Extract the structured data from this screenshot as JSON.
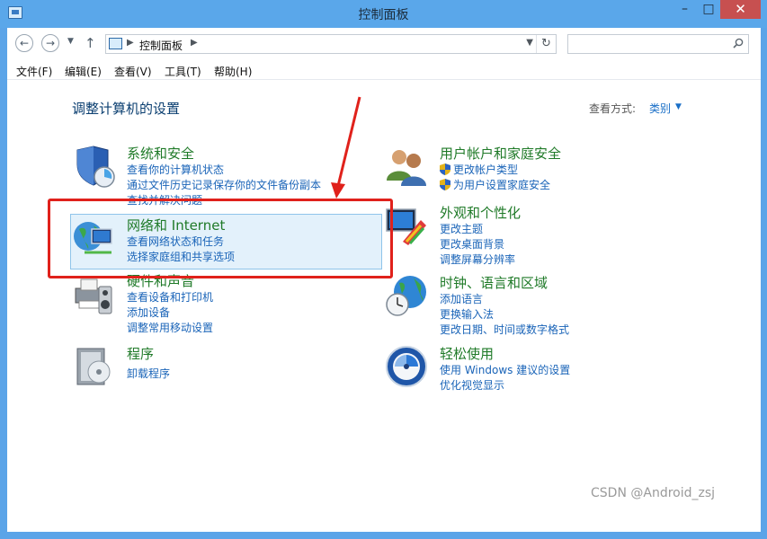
{
  "window": {
    "title": "控制面板",
    "min_icon": "minimize-icon",
    "max_icon": "maximize-icon",
    "close_icon": "close-icon"
  },
  "address_bar": {
    "path": [
      "控制面板"
    ],
    "search_placeholder": ""
  },
  "menu": [
    "文件(F)",
    "编辑(E)",
    "查看(V)",
    "工具(T)",
    "帮助(H)"
  ],
  "content": {
    "heading": "调整计算机的设置",
    "view_by_label": "查看方式:",
    "view_by_value": "类别"
  },
  "categories": {
    "system": {
      "title": "系统和安全",
      "links": [
        "查看你的计算机状态",
        "通过文件历史记录保存你的文件备份副本",
        "查找并解决问题"
      ]
    },
    "network": {
      "title": "网络和 Internet",
      "links": [
        "查看网络状态和任务",
        "选择家庭组和共享选项"
      ]
    },
    "hardware": {
      "title": "硬件和声音",
      "links": [
        "查看设备和打印机",
        "添加设备",
        "调整常用移动设置"
      ]
    },
    "programs": {
      "title": "程序",
      "links": [
        "卸载程序"
      ]
    },
    "users": {
      "title": "用户帐户和家庭安全",
      "links": [
        "更改帐户类型",
        "为用户设置家庭安全"
      ]
    },
    "appearance": {
      "title": "外观和个性化",
      "links": [
        "更改主题",
        "更改桌面背景",
        "调整屏幕分辨率"
      ]
    },
    "clock": {
      "title": "时钟、语言和区域",
      "links": [
        "添加语言",
        "更换输入法",
        "更改日期、时间或数字格式"
      ]
    },
    "ease": {
      "title": "轻松使用",
      "links": [
        "使用 Windows 建议的设置",
        "优化视觉显示"
      ]
    }
  },
  "colors": {
    "title_bar": "#5aa7ea",
    "close_button": "#c75050",
    "category_title": "#1f7a28",
    "link": "#1a64b8",
    "annotation": "#e0211b"
  },
  "watermark": "CSDN @Android_zsj"
}
